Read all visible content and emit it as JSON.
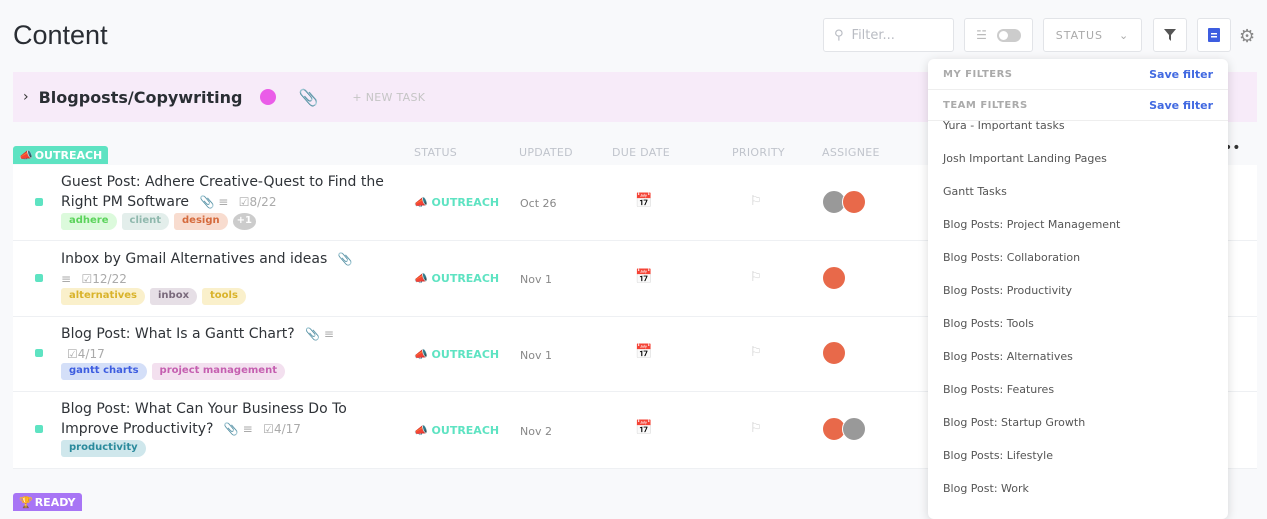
{
  "header": {
    "title": "Content",
    "filter_placeholder": "Filter...",
    "status_label": "STATUS"
  },
  "group": {
    "name": "Blogposts/Copywriting",
    "new_task": "+ NEW TASK",
    "color": "#ea5ce8"
  },
  "columns": [
    "STATUS",
    "UPDATED",
    "DUE DATE",
    "PRIORITY",
    "ASSIGNEE"
  ],
  "sections": [
    {
      "label": "OUTREACH",
      "color": "#5ee3c2",
      "icon": "megaphone-icon"
    },
    {
      "label": "READY",
      "color": "#a875f5",
      "icon": "trophy-icon"
    }
  ],
  "tasks": [
    {
      "name": "Guest Post: Adhere Creative-Quest to Find the Right PM Software",
      "checklist": "8/22",
      "tags": [
        "adhere",
        "client",
        "design"
      ],
      "more_tags": "+1",
      "status": "OUTREACH",
      "updated": "Oct 26"
    },
    {
      "name": "Inbox by Gmail Alternatives and ideas",
      "checklist": "12/22",
      "tags": [
        "alternatives",
        "inbox",
        "tools"
      ],
      "status": "OUTREACH",
      "updated": "Nov 1"
    },
    {
      "name": "Blog Post: What Is a Gantt Chart?",
      "checklist": "4/17",
      "tags": [
        "gantt charts",
        "project management"
      ],
      "status": "OUTREACH",
      "updated": "Nov 1"
    },
    {
      "name": "Blog Post: What Can Your Business Do To Improve Productivity?",
      "checklist": "4/17",
      "tags": [
        "productivity"
      ],
      "status": "OUTREACH",
      "updated": "Nov 2"
    }
  ],
  "filters_dropdown": {
    "my_filters": "MY FILTERS",
    "team_filters": "TEAM FILTERS",
    "save_filter": "Save filter",
    "items": [
      "Yura - Important tasks",
      "Josh Important Landing Pages",
      "Gantt Tasks",
      "Blog Posts: Project Management",
      "Blog Posts: Collaboration",
      "Blog Posts: Productivity",
      "Blog Posts: Tools",
      "Blog Posts: Alternatives",
      "Blog Posts: Features",
      "Blog Post: Startup Growth",
      "Blog Posts: Lifestyle",
      "Blog Post: Work"
    ]
  }
}
